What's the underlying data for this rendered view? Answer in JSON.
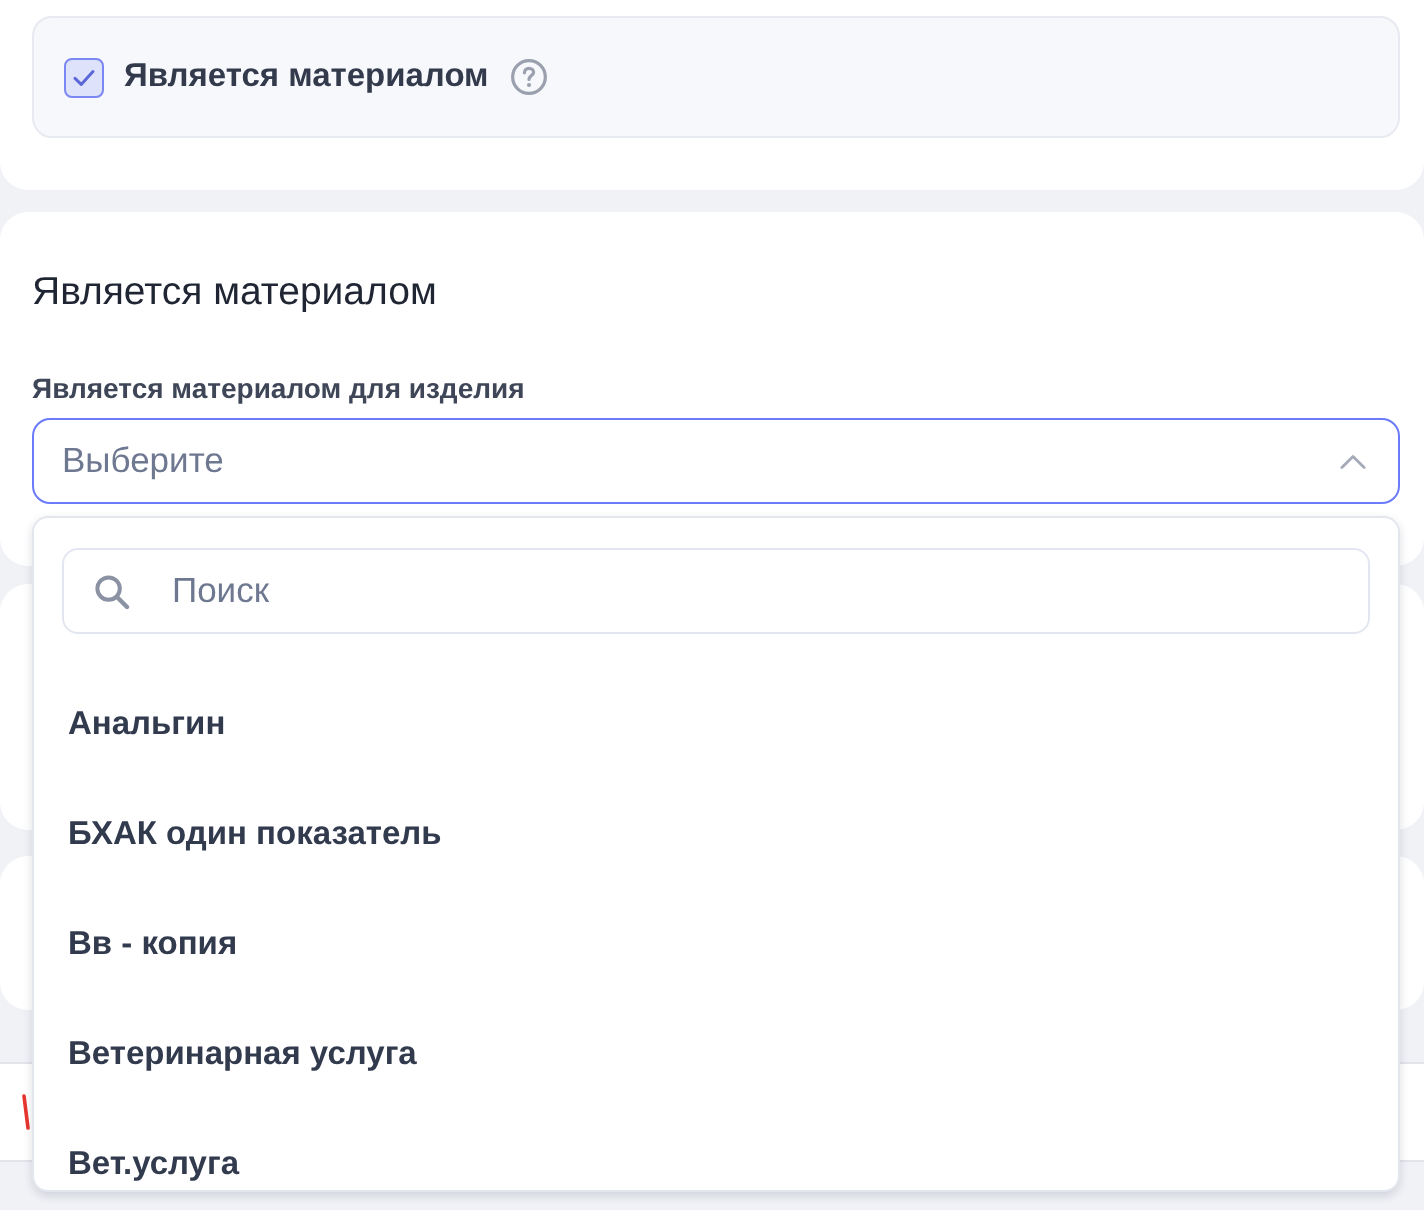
{
  "material_panel": {
    "checkbox": {
      "label": "Является материалом",
      "checked": true
    }
  },
  "section": {
    "title": "Является материалом",
    "field": {
      "label": "Является материалом для изделия",
      "placeholder": "Выберите",
      "expanded": true
    }
  },
  "dropdown": {
    "search": {
      "placeholder": "Поиск"
    },
    "options": [
      {
        "label": "Анальгин",
        "selected": false
      },
      {
        "label": "БХАК один показатель",
        "selected": false
      },
      {
        "label": "Вв - копия",
        "selected": false
      },
      {
        "label": "Ветеринарная услуга",
        "selected": false
      },
      {
        "label": "Вет.услуга",
        "selected": false
      }
    ]
  }
}
